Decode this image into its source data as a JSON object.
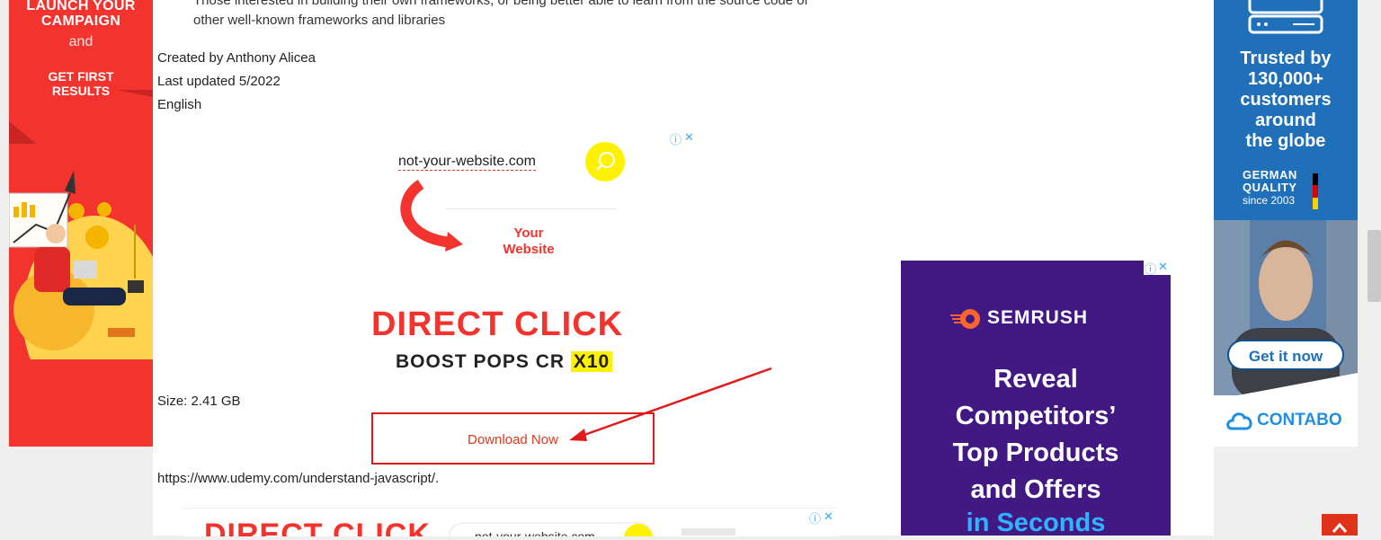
{
  "article": {
    "partial_line_1": "Those interested in building their own frameworks, or being better able to learn from the source code of",
    "partial_line_2": "other well-known frameworks and libraries",
    "created_by": "Created by Anthony Alicea",
    "last_updated": "Last updated 5/2022",
    "language": "English",
    "size": "Size: 2.41 GB",
    "download_label": "Download Now",
    "url_text": "https://www.udemy.com/understand-javascript/."
  },
  "left_ad": {
    "line1": "LAUNCH YOUR",
    "line1b": "CAMPAIGN",
    "line2": "and",
    "line3": "GET FIRST",
    "line3b": "RESULTS"
  },
  "inline_ad": {
    "domain": "not-your-website.com",
    "your": "Your",
    "website": "Website",
    "headline": "DIRECT CLICK",
    "subline": "BOOST POPS CR",
    "highlight": "X10"
  },
  "bottom_ad": {
    "headline": "DIRECT CLICK",
    "domain": "not-your-website.com"
  },
  "right_ad": {
    "trusted_1": "Trusted by",
    "trusted_2": "130,000+",
    "trusted_3": "customers",
    "trusted_4": "around",
    "trusted_5": "the globe",
    "quality_1": "GERMAN",
    "quality_2": "QUALITY",
    "since": "since 2003",
    "cta": "Get it now",
    "brand": "CONTABO"
  },
  "semrush_ad": {
    "brand": "SEMRUSH",
    "line1": "Reveal",
    "line2": "Competitors’",
    "line3": "Top Products",
    "line4": "and Offers",
    "line5": "in Seconds"
  },
  "colors": {
    "ad_red": "#f2332e",
    "contabo_blue": "#1f6fb9",
    "semrush_purple": "#421983",
    "highlight_yellow": "#fff200",
    "arrow_red": "#e01b1b"
  }
}
